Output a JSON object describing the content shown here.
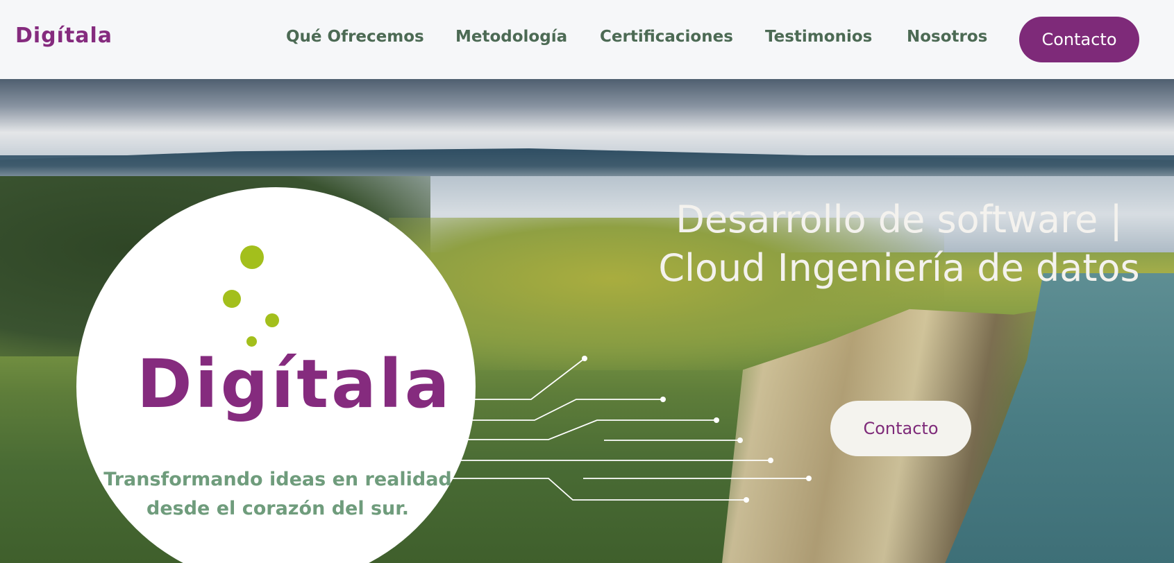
{
  "header": {
    "logo_text": "Digítala",
    "nav": [
      {
        "label": "Qué Ofrecemos"
      },
      {
        "label": "Metodología"
      },
      {
        "label": "Certificaciones"
      },
      {
        "label": "Testimonios"
      },
      {
        "label": "Nosotros"
      }
    ],
    "contact_label": "Contacto"
  },
  "hero": {
    "logo_text": "Digítala",
    "tagline": "Transformando ideas en realidad desde el corazón del sur.",
    "headline": "Desarrollo de software | Cloud Ingeniería de datos",
    "cta_label": "Contacto"
  },
  "colors": {
    "brand_purple": "#7e2a79",
    "accent_green": "#a3bf1c",
    "nav_text": "#4c6a54",
    "tagline_green": "#6f9c7c"
  }
}
